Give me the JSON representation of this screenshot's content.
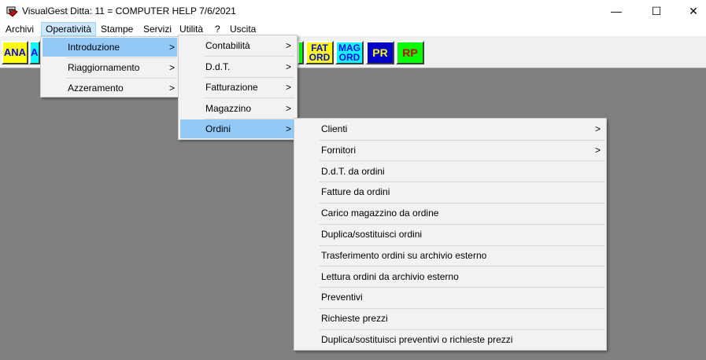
{
  "window": {
    "title": "VisualGest  Ditta: 11 = COMPUTER HELP  7/6/2021"
  },
  "window_controls": {
    "minimize": "—",
    "maximize": "☐",
    "close": "✕"
  },
  "menubar": [
    "Archivi",
    "Operatività",
    "Stampe",
    "Servizi",
    "Utilità",
    "?",
    "Uscita"
  ],
  "toolbar": {
    "ana": "ANA",
    "a": "A",
    "fat_ord_1": "FAT",
    "fat_ord_2": "ORD",
    "mag_ord_1": "MAG",
    "mag_ord_2": "ORD",
    "pr": "PR",
    "rp": "RP",
    "colors": {
      "ana_bg": "#ffff00",
      "ana_fg": "#0000ff",
      "fat_bg": "#ffff00",
      "fat_fg": "#0000ff",
      "mag_bg": "#00ffff",
      "mag_fg": "#0000ff",
      "pr_bg": "#0000cc",
      "pr_fg": "#ffff00",
      "rp_bg": "#00ff00",
      "rp_fg": "#cc0000",
      "green_bg": "#00ff00"
    }
  },
  "menu_operativita": {
    "items": [
      {
        "label": "Introduzione",
        "arrow": ">"
      },
      {
        "label": "Riaggiornamento",
        "arrow": ">"
      },
      {
        "label": "Azzeramento",
        "arrow": ">"
      }
    ]
  },
  "menu_introduzione": {
    "items": [
      {
        "label": "Contabilità",
        "arrow": ">"
      },
      {
        "label": "D.d.T.",
        "arrow": ">"
      },
      {
        "label": "Fatturazione",
        "arrow": ">"
      },
      {
        "label": "Magazzino",
        "arrow": ">"
      },
      {
        "label": "Ordini",
        "arrow": ">"
      }
    ]
  },
  "menu_ordini": {
    "items": [
      {
        "label": "Clienti",
        "arrow": ">"
      },
      {
        "label": "Fornitori",
        "arrow": ">"
      },
      {
        "label": "D.d.T. da ordini"
      },
      {
        "label": "Fatture da ordini"
      },
      {
        "label": "Carico magazzino da ordine"
      },
      {
        "label": "Duplica/sostituisci ordini"
      },
      {
        "label": "Trasferimento ordini su archivio esterno"
      },
      {
        "label": "Lettura ordini da archivio esterno"
      },
      {
        "label": "Preventivi"
      },
      {
        "label": "Richieste prezzi"
      },
      {
        "label": "Duplica/sostituisci preventivi o richieste prezzi"
      }
    ]
  },
  "colors": {
    "highlight": "#91c9f7",
    "menu_bg": "#f2f2f2",
    "desktop": "#808080",
    "menubar_active": "#cce8ff"
  }
}
